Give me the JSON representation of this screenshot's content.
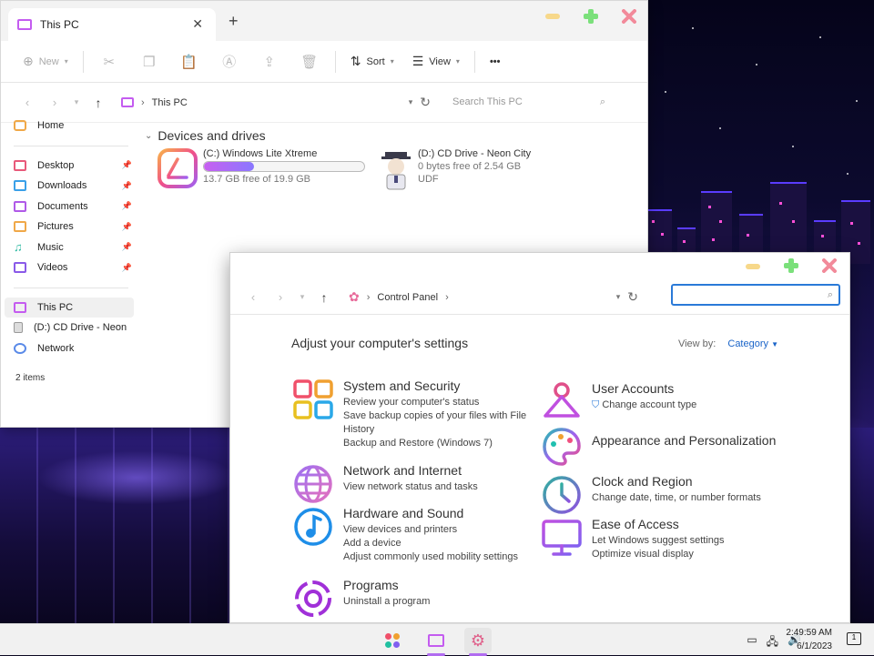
{
  "explorer": {
    "tab_title": "This PC",
    "toolbar": {
      "new_label": "New",
      "sort_label": "Sort",
      "view_label": "View",
      "more_label": "•••"
    },
    "address": {
      "path": "This PC",
      "search_placeholder": "Search This PC"
    },
    "sidebar": {
      "home": "Home",
      "quick": [
        {
          "label": "Desktop"
        },
        {
          "label": "Downloads"
        },
        {
          "label": "Documents"
        },
        {
          "label": "Pictures"
        },
        {
          "label": "Music"
        },
        {
          "label": "Videos"
        }
      ],
      "this_pc": "This PC",
      "cd_drive": "(D:) CD Drive - Neon",
      "network": "Network"
    },
    "section_title": "Devices and drives",
    "drives": [
      {
        "name": "(C:) Windows Lite Xtreme",
        "free": "13.7 GB free of 19.9 GB",
        "used_fraction": 0.31
      },
      {
        "name": "(D:) CD Drive - Neon City",
        "free": "0 bytes free of 2.54 GB",
        "fs": "UDF"
      }
    ],
    "status": "2 items"
  },
  "control_panel": {
    "path": "Control Panel",
    "heading": "Adjust your computer's settings",
    "view_by_label": "View by:",
    "view_by_value": "Category",
    "left_categories": [
      {
        "title": "System and Security",
        "links": [
          "Review your computer's status",
          "Save backup copies of your files with File History",
          "Backup and Restore (Windows 7)"
        ],
        "icon": "system-security-icon"
      },
      {
        "title": "Network and Internet",
        "links": [
          "View network status and tasks"
        ],
        "icon": "globe-icon"
      },
      {
        "title": "Hardware and Sound",
        "links": [
          "View devices and printers",
          "Add a device",
          "Adjust commonly used mobility settings"
        ],
        "icon": "music-note-icon"
      },
      {
        "title": "Programs",
        "links": [
          "Uninstall a program"
        ],
        "icon": "programs-icon"
      }
    ],
    "right_categories": [
      {
        "title": "User Accounts",
        "links": [
          "Change account type"
        ],
        "icon": "user-icon"
      },
      {
        "title": "Appearance and Personalization",
        "links": [],
        "icon": "palette-icon"
      },
      {
        "title": "Clock and Region",
        "links": [
          "Change date, time, or number formats"
        ],
        "icon": "clock-icon"
      },
      {
        "title": "Ease of Access",
        "links": [
          "Let Windows suggest settings",
          "Optimize visual display"
        ],
        "icon": "monitor-icon"
      }
    ]
  },
  "taskbar": {
    "time": "2:49:59 AM",
    "date": "6/1/2023",
    "notification_count": "1"
  },
  "colors": {
    "accent_purple": "#c45cf0",
    "link_blue": "#1a64c8",
    "min_yellow": "#f7d88a",
    "max_green": "#7be07b",
    "close_red": "#f28a9a"
  }
}
